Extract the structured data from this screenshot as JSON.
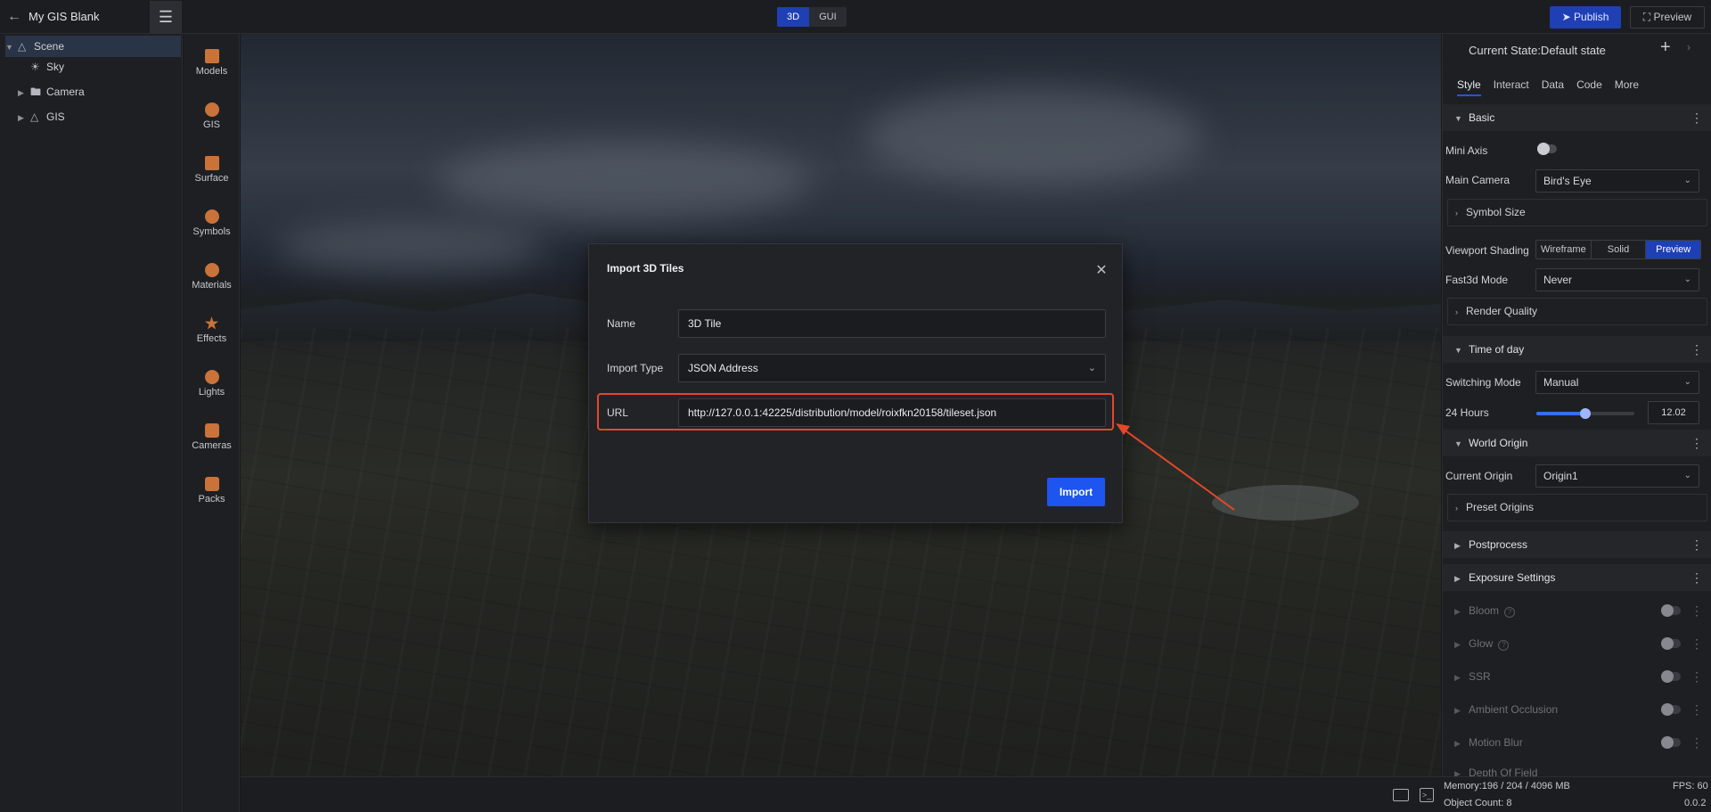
{
  "header": {
    "app_title": "My GIS Blank",
    "mode_tabs": [
      "3D",
      "GUI"
    ],
    "active_mode": "3D",
    "publish_label": "Publish",
    "preview_label": "Preview"
  },
  "scene_tree": {
    "items": [
      {
        "label": "Scene",
        "icon": "scene-icon",
        "expanded": true,
        "selected": true
      },
      {
        "label": "Sky",
        "icon": "sky-icon"
      },
      {
        "label": "Camera",
        "icon": "folder-icon",
        "collapsed": true
      },
      {
        "label": "GIS",
        "icon": "gis-icon",
        "collapsed": true
      }
    ]
  },
  "tool_rail": {
    "items": [
      {
        "label": "Models",
        "icon": "models-icon"
      },
      {
        "label": "GIS",
        "icon": "gis-icon"
      },
      {
        "label": "Surface",
        "icon": "surface-icon"
      },
      {
        "label": "Symbols",
        "icon": "symbols-icon"
      },
      {
        "label": "Materials",
        "icon": "materials-icon"
      },
      {
        "label": "Effects",
        "icon": "effects-icon"
      },
      {
        "label": "Lights",
        "icon": "lights-icon"
      },
      {
        "label": "Cameras",
        "icon": "cameras-icon"
      },
      {
        "label": "Packs",
        "icon": "packs-icon"
      }
    ]
  },
  "dialog": {
    "title": "Import 3D Tiles",
    "fields": {
      "name_label": "Name",
      "name_value": "3D Tile",
      "import_type_label": "Import Type",
      "import_type_value": "JSON Address",
      "url_label": "URL",
      "url_value": "http://127.0.0.1:42225/distribution/model/roixfkn20158/tileset.json"
    },
    "import_label": "Import"
  },
  "right_panel": {
    "current_state": "Current State:Default state",
    "tabs": [
      "Style",
      "Interact",
      "Data",
      "Code",
      "More"
    ],
    "active_tab": "Style",
    "basic": {
      "title": "Basic",
      "mini_axis_label": "Mini Axis",
      "main_camera_label": "Main Camera",
      "main_camera_value": "Bird's Eye",
      "symbol_size_label": "Symbol Size",
      "viewport_shading_label": "Viewport Shading",
      "shading_options": [
        "Wireframe",
        "Solid",
        "Preview"
      ],
      "active_shading": "Preview",
      "fast3d_label": "Fast3d Mode",
      "fast3d_value": "Never",
      "render_quality_label": "Render Quality"
    },
    "time_of_day": {
      "title": "Time of day",
      "switching_mode_label": "Switching Mode",
      "switching_mode_value": "Manual",
      "hours_label": "24 Hours",
      "hours_value": "12.02",
      "hours_fraction": 0.5
    },
    "world_origin": {
      "title": "World Origin",
      "current_origin_label": "Current Origin",
      "current_origin_value": "Origin1",
      "preset_origins_label": "Preset Origins"
    },
    "postprocess_label": "Postprocess",
    "exposure_label": "Exposure Settings",
    "effects": [
      "Bloom",
      "Glow",
      "SSR",
      "Ambient Occlusion",
      "Motion Blur",
      "Depth Of Field"
    ]
  },
  "status": {
    "memory": "Memory:196 / 204 / 4096 MB",
    "fps": "FPS: 60",
    "object_count": "Object Count: 8",
    "version": "0.0.2"
  },
  "colors": {
    "accent": "#1f3fb5",
    "import_button": "#1e55f0",
    "highlight": "#e5472a"
  }
}
